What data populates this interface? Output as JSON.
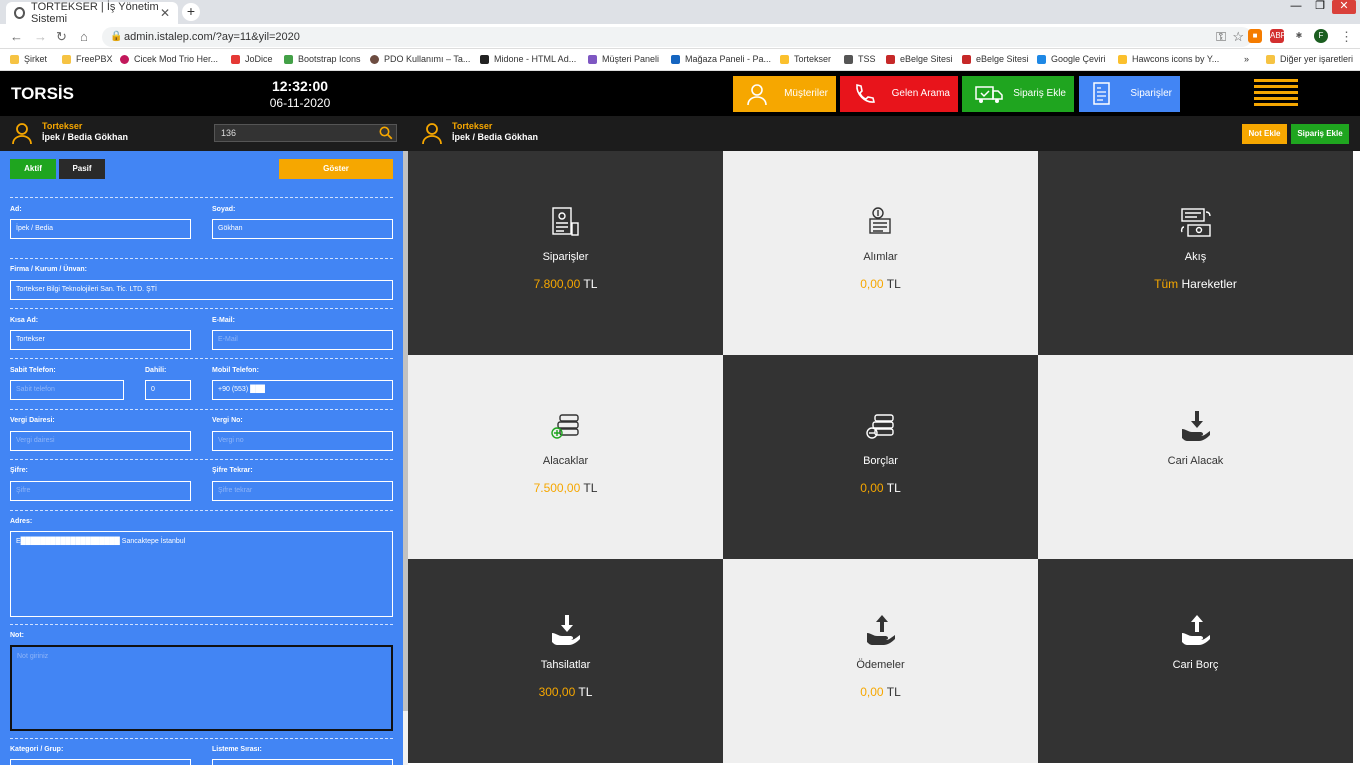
{
  "browser": {
    "tab_title": "TORTEKSER | İş Yönetim Sistemi",
    "url": "admin.istalep.com/?ay=11&yil=2020",
    "bookmarks": [
      "Şirket",
      "FreePBX",
      "Cicek Mod Trio Her...",
      "JoDice",
      "Bootstrap Icons",
      "PDO Kullanımı – Ta...",
      "Midone - HTML Ad...",
      "Müşteri Paneli",
      "Mağaza Paneli - Pa...",
      "Tortekser",
      "TSS",
      "eBelge Sitesi",
      "eBelge Sitesi",
      "Google Çeviri",
      "Hawcons icons by Y..."
    ],
    "other_bookmarks": "Diğer yer işaretleri",
    "profile_initial": "F"
  },
  "header": {
    "brand": "TORSİS",
    "time": "12:32:00",
    "date": "06-11-2020",
    "buttons": [
      {
        "label": "Müşteriler",
        "color": "#f6a700"
      },
      {
        "label": "Gelen Arama",
        "color": "#e8141b"
      },
      {
        "label": "Sipariş Ekle",
        "color": "#1fa51f"
      },
      {
        "label": "Siparişler",
        "color": "#4285f4"
      }
    ]
  },
  "subbar": {
    "company": "Tortekser",
    "person": "İpek / Bedia Gökhan",
    "search_value": "136",
    "note_button": "Not Ekle",
    "order_button": "Sipariş Ekle"
  },
  "form": {
    "active_label": "Aktif",
    "passive_label": "Pasif",
    "show_label": "Göster",
    "ad_label": "Ad:",
    "ad_value": "İpek / Bedia",
    "soyad_label": "Soyad:",
    "soyad_value": "Gökhan",
    "firma_label": "Firma / Kurum / Ünvan:",
    "firma_value": "Tortekser Bilgi Teknolojileri San. Tic. LTD. ŞTİ",
    "kisa_label": "Kısa Ad:",
    "kisa_value": "Tortekser",
    "email_label": "E-Mail:",
    "email_placeholder": "E-Mail",
    "sabit_label": "Sabit Telefon:",
    "sabit_placeholder": "Sabit telefon",
    "dahili_label": "Dahili:",
    "dahili_value": "0",
    "mobil_label": "Mobil Telefon:",
    "mobil_value": "+90 (553) ███",
    "vd_label": "Vergi Dairesi:",
    "vd_placeholder": "Vergi dairesi",
    "vno_label": "Vergi No:",
    "vno_placeholder": "Vergi no",
    "sifre_label": "Şifre:",
    "sifre_placeholder": "Şifre",
    "sifre2_label": "Şifre Tekrar:",
    "sifre2_placeholder": "Şifre tekrar",
    "adres_label": "Adres:",
    "adres_value": "E████████████████████ Sancaktepe İstanbul",
    "not_label": "Not:",
    "not_placeholder": "Not giriniz",
    "kategori_label": "Kategori / Grup:",
    "liste_label": "Listeme Sırası:"
  },
  "cards": [
    {
      "title": "Siparişler",
      "value": "7.800,00",
      "unit": "TL",
      "icon": "order-icon"
    },
    {
      "title": "Alımlar",
      "value": "0,00",
      "unit": "TL",
      "icon": "purchase-icon"
    },
    {
      "title": "Akış",
      "value": "Tüm",
      "unit": "Hareketler",
      "icon": "flow-icon"
    },
    {
      "title": "Alacaklar",
      "value": "7.500,00",
      "unit": "TL",
      "icon": "receivables-icon"
    },
    {
      "title": "Borçlar",
      "value": "0,00",
      "unit": "TL",
      "icon": "debts-icon"
    },
    {
      "title": "Cari Alacak",
      "value": "",
      "unit": "",
      "icon": "current-receivable-icon"
    },
    {
      "title": "Tahsilatlar",
      "value": "300,00",
      "unit": "TL",
      "icon": "collections-icon"
    },
    {
      "title": "Ödemeler",
      "value": "0,00",
      "unit": "TL",
      "icon": "payments-icon"
    },
    {
      "title": "Cari Borç",
      "value": "",
      "unit": "",
      "icon": "current-debt-icon"
    }
  ]
}
